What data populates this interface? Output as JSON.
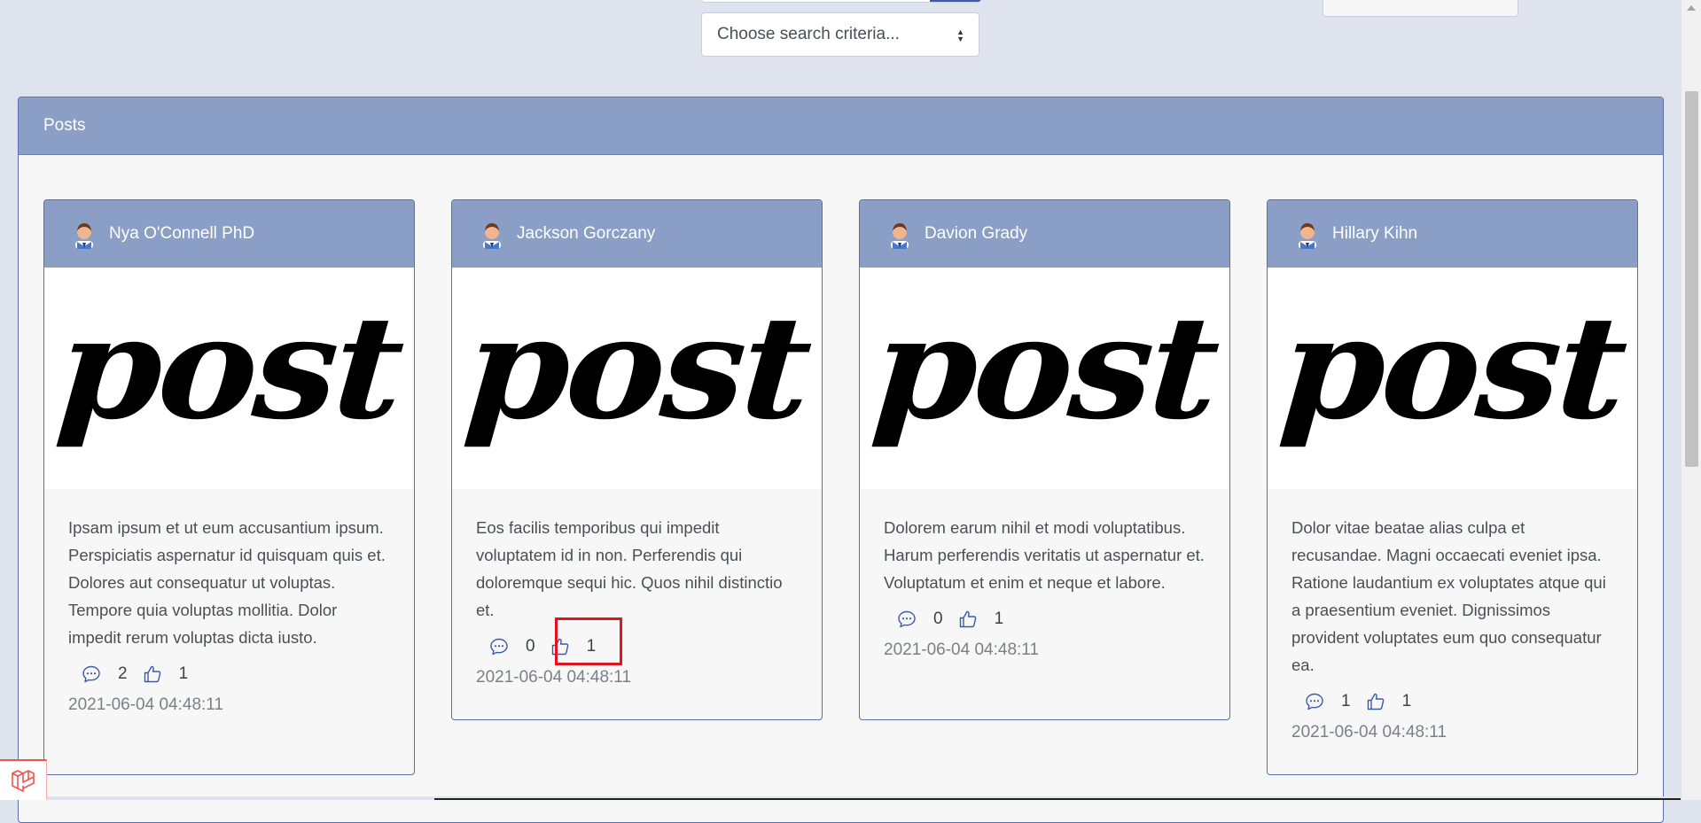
{
  "search": {
    "criteria_placeholder": "Choose search criteria..."
  },
  "panel": {
    "title": "Posts"
  },
  "posts": [
    {
      "author": "Nya O'Connell PhD",
      "image_text": "post",
      "body": "Ipsam ipsum et ut eum accusantium ipsum. Perspiciatis aspernatur id quisquam quis et. Dolores aut consequatur ut voluptas. Tempore quia voluptas mollitia. Dolor impedit rerum voluptas dicta iusto.",
      "comments": "2",
      "likes": "1",
      "date": "2021-06-04 04:48:11"
    },
    {
      "author": "Jackson Gorczany",
      "image_text": "post",
      "body": "Eos facilis temporibus qui impedit voluptatem id in non. Perferendis qui doloremque sequi hic. Quos nihil distinctio et.",
      "comments": "0",
      "likes": "1",
      "date": "2021-06-04 04:48:11"
    },
    {
      "author": "Davion Grady",
      "image_text": "post",
      "body": "Dolorem earum nihil et modi voluptatibus. Harum perferendis veritatis ut aspernatur et. Voluptatum et enim et neque et labore.",
      "comments": "0",
      "likes": "1",
      "date": "2021-06-04 04:48:11"
    },
    {
      "author": "Hillary Kihn",
      "image_text": "post",
      "body": "Dolor vitae beatae alias culpa et recusandae. Magni occaecati eveniet ipsa. Ratione laudantium ex voluptates atque qui a praesentium eveniet. Dignissimos provident voluptates eum quo consequatur ea.",
      "comments": "1",
      "likes": "1",
      "date": "2021-06-04 04:48:11"
    }
  ],
  "colors": {
    "header_bg": "#8a9ec6",
    "border": "#5a70a8",
    "icon": "#3b5aa8",
    "highlight": "#e0141c"
  },
  "icons": {
    "comment": "speech-bubble-icon",
    "like": "thumbs-up-icon",
    "avatar": "user-avatar-icon",
    "badge": "laravel-logo-icon"
  }
}
